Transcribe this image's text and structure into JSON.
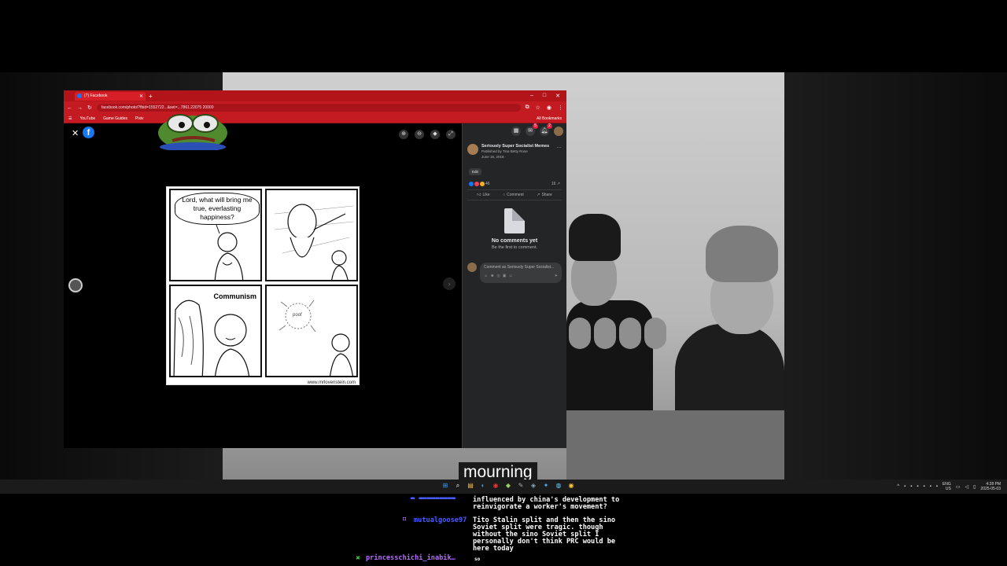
{
  "browser": {
    "tab_title": "(7) Facebook",
    "url": "facebook.com/photo/?fbid=1552722...&set=...7861.22075 20000",
    "nav": {
      "back": "←",
      "forward": "→",
      "reload": "↻",
      "menu": "☰"
    },
    "bookmarks": [
      "YouTube",
      "Game Guides",
      "Pixiv"
    ],
    "all_bookmarks": "All Bookmarks",
    "window_controls": {
      "minimize": "–",
      "maximize": "□",
      "close": "✕"
    }
  },
  "viewer": {
    "close": "✕",
    "logo": "f",
    "tools": [
      "⊕",
      "⊖",
      "◆",
      "⤢"
    ],
    "next": "›"
  },
  "comic": {
    "panel1_text": "Lord, what will bring me true, everlasting happiness?",
    "panel3_text": "Communism",
    "panel4_text": "poof",
    "watermark": "www.mrlovenstein.com"
  },
  "post": {
    "page_name": "Seriously Super Socialist Memes",
    "published_by": "Published by Tina Betty Rose",
    "date": "June 16, 2018 · ",
    "more": "…",
    "edit": "Edit",
    "reaction_count": "46",
    "share_count": "16 ↗",
    "actions": {
      "like": "Like",
      "comment": "Comment",
      "share": "Share"
    },
    "no_comments_title": "No comments yet",
    "no_comments_sub": "Be the first to comment.",
    "comment_placeholder": "Comment as Seriously Super Socialist...",
    "top_badges": {
      "messenger": "5",
      "notifications": "2"
    }
  },
  "caption": "mourning",
  "taskbar": {
    "tray_lang": "ENG\nUS",
    "clock_time": "4:28 PM",
    "clock_date": "2025-05-03"
  },
  "chat": {
    "messages": [
      {
        "user": "",
        "text": "influenced by china's development to"
      },
      {
        "user": "",
        "text": "reinvigorate a worker's movement?"
      },
      {
        "user": "mutualgoose97",
        "text": "Tito Stalin split and then the sino"
      },
      {
        "user": "",
        "text": "Soviet split were tragic. though"
      },
      {
        "user": "",
        "text": "without the sino Soviet split I"
      },
      {
        "user": "",
        "text": "personally don't think PRC would be"
      },
      {
        "user": "",
        "text": "here today"
      },
      {
        "user": "princesschichi_inabik…",
        "text": "so"
      }
    ]
  },
  "colors": {
    "browser_red": "#c41b22",
    "fb_blue": "#1877f2",
    "fb_panel": "#242526",
    "chat_user_blue": "#4a5cff",
    "chat_user_purple": "#b66cff"
  }
}
